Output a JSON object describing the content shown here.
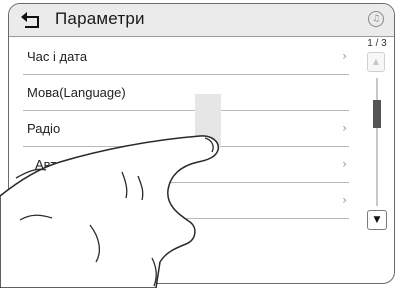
{
  "header": {
    "title": "Параметри",
    "back_icon": "back-arrow-icon",
    "fav_icon": "music-note-icon",
    "fav_glyph": "♫"
  },
  "menu": {
    "items": [
      {
        "label": "Час і дата",
        "chevron": "›"
      },
      {
        "label": "Мова(Language)",
        "chevron": ""
      },
      {
        "label": "Радіо",
        "chevron": "›"
      },
      {
        "label": "Автомобіль",
        "chevron": "›"
      },
      {
        "label": "",
        "chevron": "›"
      }
    ]
  },
  "scroll": {
    "page_indicator": "1 / 3",
    "up_glyph": "▲",
    "down_glyph": "▼"
  },
  "colors": {
    "header_bg": "#ebebeb",
    "border": "#6a6a6a",
    "divider": "#b8b8b8",
    "thumb": "#555555"
  }
}
